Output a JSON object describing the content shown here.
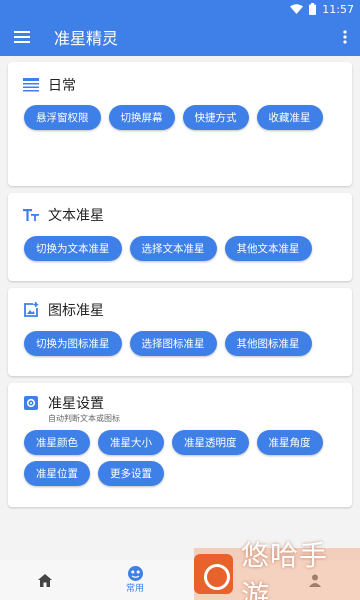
{
  "status_bar": {
    "time": "11:57"
  },
  "app_bar": {
    "title": "准星精灵"
  },
  "cards": {
    "daily": {
      "title": "日常",
      "chips": [
        "悬浮窗权限",
        "切换屏幕",
        "快捷方式",
        "收藏准星"
      ]
    },
    "text": {
      "title": "文本准星",
      "chips": [
        "切换为文本准星",
        "选择文本准星",
        "其他文本准星"
      ]
    },
    "icon": {
      "title": "图标准星",
      "chips": [
        "切换为图标准星",
        "选择图标准星",
        "其他图标准星"
      ]
    },
    "settings": {
      "title": "准星设置",
      "subtitle": "自动判断文本或图标",
      "chips": [
        "准星颜色",
        "准星大小",
        "准星透明度",
        "准星角度",
        "准星位置",
        "更多设置"
      ]
    }
  },
  "bottom_nav": {
    "items": [
      {
        "icon": "home-icon",
        "label": ""
      },
      {
        "icon": "common-icon",
        "label": "常用"
      },
      {
        "icon": "game-icon",
        "label": ""
      },
      {
        "icon": "profile-icon",
        "label": ""
      }
    ]
  },
  "watermark": {
    "text": "悠哈手游"
  },
  "colors": {
    "primary": "#3f80e8",
    "background": "#f3f3f3",
    "card": "#ffffff",
    "watermark": "#e8622b"
  }
}
